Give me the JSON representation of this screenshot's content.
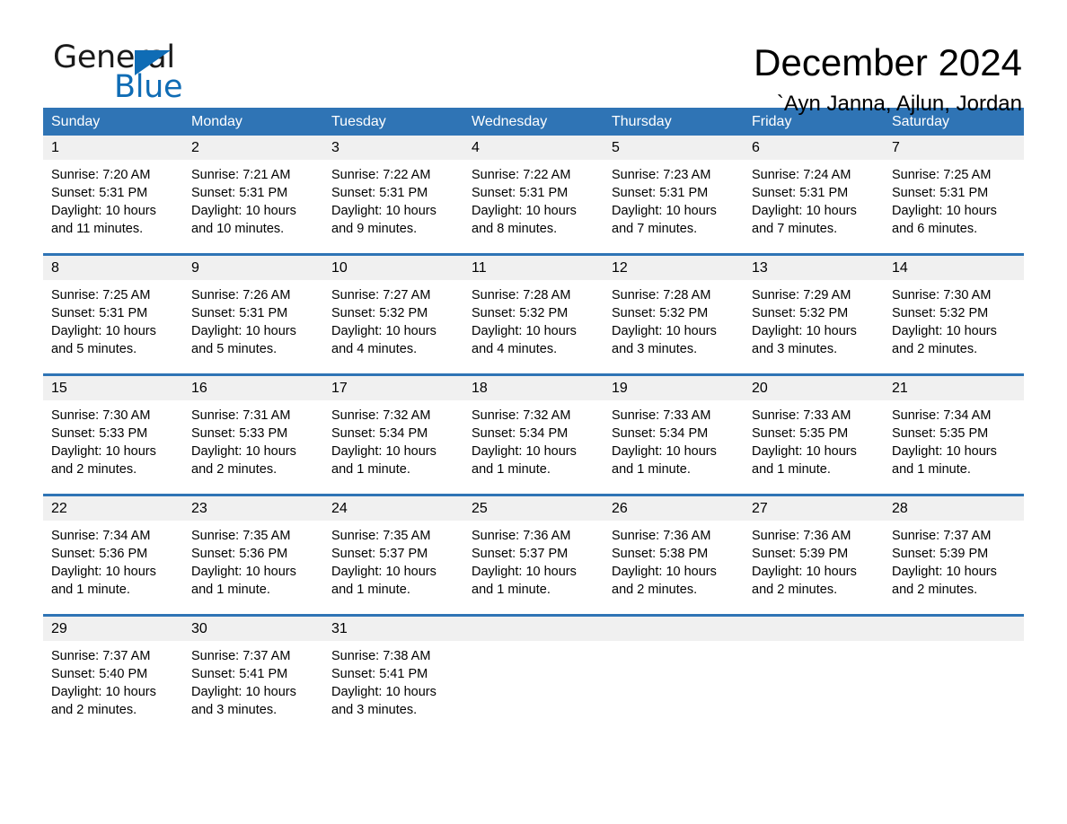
{
  "brand": {
    "word_one": "General",
    "word_two": "Blue",
    "accent_color": "#0f6cb5"
  },
  "header": {
    "title": "December 2024",
    "location": "`Ayn Janna, Ajlun, Jordan"
  },
  "calendar": {
    "header_bg": "#2f74b5",
    "day_band_bg": "#f0f0f0",
    "weekday_headers": [
      "Sunday",
      "Monday",
      "Tuesday",
      "Wednesday",
      "Thursday",
      "Friday",
      "Saturday"
    ],
    "weeks": [
      [
        {
          "day": "1",
          "sunrise": "Sunrise: 7:20 AM",
          "sunset": "Sunset: 5:31 PM",
          "daylight_line1": "Daylight: 10 hours",
          "daylight_line2": "and 11 minutes."
        },
        {
          "day": "2",
          "sunrise": "Sunrise: 7:21 AM",
          "sunset": "Sunset: 5:31 PM",
          "daylight_line1": "Daylight: 10 hours",
          "daylight_line2": "and 10 minutes."
        },
        {
          "day": "3",
          "sunrise": "Sunrise: 7:22 AM",
          "sunset": "Sunset: 5:31 PM",
          "daylight_line1": "Daylight: 10 hours",
          "daylight_line2": "and 9 minutes."
        },
        {
          "day": "4",
          "sunrise": "Sunrise: 7:22 AM",
          "sunset": "Sunset: 5:31 PM",
          "daylight_line1": "Daylight: 10 hours",
          "daylight_line2": "and 8 minutes."
        },
        {
          "day": "5",
          "sunrise": "Sunrise: 7:23 AM",
          "sunset": "Sunset: 5:31 PM",
          "daylight_line1": "Daylight: 10 hours",
          "daylight_line2": "and 7 minutes."
        },
        {
          "day": "6",
          "sunrise": "Sunrise: 7:24 AM",
          "sunset": "Sunset: 5:31 PM",
          "daylight_line1": "Daylight: 10 hours",
          "daylight_line2": "and 7 minutes."
        },
        {
          "day": "7",
          "sunrise": "Sunrise: 7:25 AM",
          "sunset": "Sunset: 5:31 PM",
          "daylight_line1": "Daylight: 10 hours",
          "daylight_line2": "and 6 minutes."
        }
      ],
      [
        {
          "day": "8",
          "sunrise": "Sunrise: 7:25 AM",
          "sunset": "Sunset: 5:31 PM",
          "daylight_line1": "Daylight: 10 hours",
          "daylight_line2": "and 5 minutes."
        },
        {
          "day": "9",
          "sunrise": "Sunrise: 7:26 AM",
          "sunset": "Sunset: 5:31 PM",
          "daylight_line1": "Daylight: 10 hours",
          "daylight_line2": "and 5 minutes."
        },
        {
          "day": "10",
          "sunrise": "Sunrise: 7:27 AM",
          "sunset": "Sunset: 5:32 PM",
          "daylight_line1": "Daylight: 10 hours",
          "daylight_line2": "and 4 minutes."
        },
        {
          "day": "11",
          "sunrise": "Sunrise: 7:28 AM",
          "sunset": "Sunset: 5:32 PM",
          "daylight_line1": "Daylight: 10 hours",
          "daylight_line2": "and 4 minutes."
        },
        {
          "day": "12",
          "sunrise": "Sunrise: 7:28 AM",
          "sunset": "Sunset: 5:32 PM",
          "daylight_line1": "Daylight: 10 hours",
          "daylight_line2": "and 3 minutes."
        },
        {
          "day": "13",
          "sunrise": "Sunrise: 7:29 AM",
          "sunset": "Sunset: 5:32 PM",
          "daylight_line1": "Daylight: 10 hours",
          "daylight_line2": "and 3 minutes."
        },
        {
          "day": "14",
          "sunrise": "Sunrise: 7:30 AM",
          "sunset": "Sunset: 5:32 PM",
          "daylight_line1": "Daylight: 10 hours",
          "daylight_line2": "and 2 minutes."
        }
      ],
      [
        {
          "day": "15",
          "sunrise": "Sunrise: 7:30 AM",
          "sunset": "Sunset: 5:33 PM",
          "daylight_line1": "Daylight: 10 hours",
          "daylight_line2": "and 2 minutes."
        },
        {
          "day": "16",
          "sunrise": "Sunrise: 7:31 AM",
          "sunset": "Sunset: 5:33 PM",
          "daylight_line1": "Daylight: 10 hours",
          "daylight_line2": "and 2 minutes."
        },
        {
          "day": "17",
          "sunrise": "Sunrise: 7:32 AM",
          "sunset": "Sunset: 5:34 PM",
          "daylight_line1": "Daylight: 10 hours",
          "daylight_line2": "and 1 minute."
        },
        {
          "day": "18",
          "sunrise": "Sunrise: 7:32 AM",
          "sunset": "Sunset: 5:34 PM",
          "daylight_line1": "Daylight: 10 hours",
          "daylight_line2": "and 1 minute."
        },
        {
          "day": "19",
          "sunrise": "Sunrise: 7:33 AM",
          "sunset": "Sunset: 5:34 PM",
          "daylight_line1": "Daylight: 10 hours",
          "daylight_line2": "and 1 minute."
        },
        {
          "day": "20",
          "sunrise": "Sunrise: 7:33 AM",
          "sunset": "Sunset: 5:35 PM",
          "daylight_line1": "Daylight: 10 hours",
          "daylight_line2": "and 1 minute."
        },
        {
          "day": "21",
          "sunrise": "Sunrise: 7:34 AM",
          "sunset": "Sunset: 5:35 PM",
          "daylight_line1": "Daylight: 10 hours",
          "daylight_line2": "and 1 minute."
        }
      ],
      [
        {
          "day": "22",
          "sunrise": "Sunrise: 7:34 AM",
          "sunset": "Sunset: 5:36 PM",
          "daylight_line1": "Daylight: 10 hours",
          "daylight_line2": "and 1 minute."
        },
        {
          "day": "23",
          "sunrise": "Sunrise: 7:35 AM",
          "sunset": "Sunset: 5:36 PM",
          "daylight_line1": "Daylight: 10 hours",
          "daylight_line2": "and 1 minute."
        },
        {
          "day": "24",
          "sunrise": "Sunrise: 7:35 AM",
          "sunset": "Sunset: 5:37 PM",
          "daylight_line1": "Daylight: 10 hours",
          "daylight_line2": "and 1 minute."
        },
        {
          "day": "25",
          "sunrise": "Sunrise: 7:36 AM",
          "sunset": "Sunset: 5:37 PM",
          "daylight_line1": "Daylight: 10 hours",
          "daylight_line2": "and 1 minute."
        },
        {
          "day": "26",
          "sunrise": "Sunrise: 7:36 AM",
          "sunset": "Sunset: 5:38 PM",
          "daylight_line1": "Daylight: 10 hours",
          "daylight_line2": "and 2 minutes."
        },
        {
          "day": "27",
          "sunrise": "Sunrise: 7:36 AM",
          "sunset": "Sunset: 5:39 PM",
          "daylight_line1": "Daylight: 10 hours",
          "daylight_line2": "and 2 minutes."
        },
        {
          "day": "28",
          "sunrise": "Sunrise: 7:37 AM",
          "sunset": "Sunset: 5:39 PM",
          "daylight_line1": "Daylight: 10 hours",
          "daylight_line2": "and 2 minutes."
        }
      ],
      [
        {
          "day": "29",
          "sunrise": "Sunrise: 7:37 AM",
          "sunset": "Sunset: 5:40 PM",
          "daylight_line1": "Daylight: 10 hours",
          "daylight_line2": "and 2 minutes."
        },
        {
          "day": "30",
          "sunrise": "Sunrise: 7:37 AM",
          "sunset": "Sunset: 5:41 PM",
          "daylight_line1": "Daylight: 10 hours",
          "daylight_line2": "and 3 minutes."
        },
        {
          "day": "31",
          "sunrise": "Sunrise: 7:38 AM",
          "sunset": "Sunset: 5:41 PM",
          "daylight_line1": "Daylight: 10 hours",
          "daylight_line2": "and 3 minutes."
        },
        {
          "day": "",
          "sunrise": "",
          "sunset": "",
          "daylight_line1": "",
          "daylight_line2": ""
        },
        {
          "day": "",
          "sunrise": "",
          "sunset": "",
          "daylight_line1": "",
          "daylight_line2": ""
        },
        {
          "day": "",
          "sunrise": "",
          "sunset": "",
          "daylight_line1": "",
          "daylight_line2": ""
        },
        {
          "day": "",
          "sunrise": "",
          "sunset": "",
          "daylight_line1": "",
          "daylight_line2": ""
        }
      ]
    ]
  }
}
